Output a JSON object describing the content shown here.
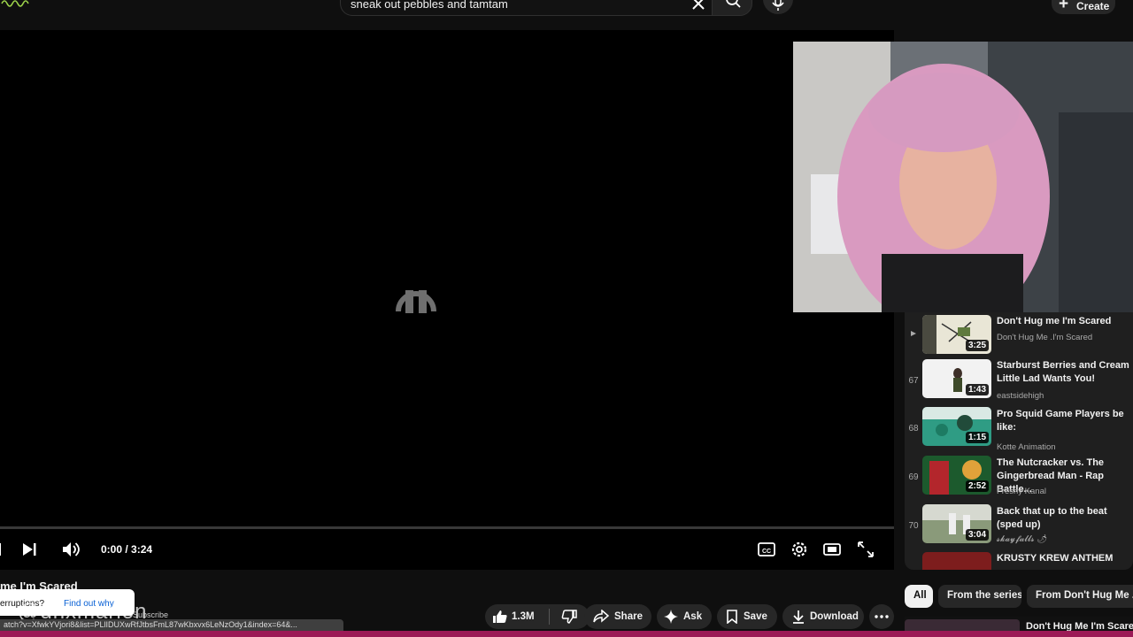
{
  "search": {
    "query": "sneak out pebbles and tamtam"
  },
  "header": {
    "create_label": "Create"
  },
  "player": {
    "time": "0:00 / 3:24",
    "progress_fraction": 0.0,
    "state": "loading"
  },
  "video": {
    "title_fragment": "me I'm Scared",
    "notice_question": "erruptions?",
    "notice_link": "Find out why",
    "watermark": "@dnxmarion",
    "subscribe_fragment": "Subscribe",
    "url_fragment": "atch?v=XfwkYVjori8&list=PLlIDUXwRfJtbsFmL87wKbxvx6LeNzOdy1&index=64&..."
  },
  "actions": {
    "like_count": "1.3M",
    "share": "Share",
    "ask": "Ask",
    "save": "Save",
    "download": "Download"
  },
  "playlist": [
    {
      "index": "",
      "now_playing": true,
      "title": "Don't Hug me I'm Scared",
      "channel": "Don't Hug Me .I'm Scared",
      "duration": "3:25"
    },
    {
      "index": "67",
      "title": "Starburst Berries and Cream Little Lad Wants You!",
      "channel": "eastsidehigh",
      "duration": "1:43"
    },
    {
      "index": "68",
      "title": "Pro Squid Game Players be like:",
      "channel": "Kotte Animation",
      "duration": "1:15"
    },
    {
      "index": "69",
      "title": "The Nutcracker vs. The Gingerbread Man - Rap Battle...",
      "channel": "Freshy Kanal",
      "duration": "2:52"
    },
    {
      "index": "70",
      "title": "Back that up to the beat (sped up)",
      "channel": "𝓼𝓴𝓪𝔂𝓯𝓪𝓵𝓵𝓼 🌶",
      "duration": "3:04"
    },
    {
      "index": "",
      "title": "KRUSTY KREW ANTHEM",
      "channel": "",
      "duration": ""
    }
  ],
  "chips": [
    "All",
    "From the series",
    "From Don't Hug Me .I'm"
  ],
  "related": {
    "first_title": "Don't Hug Me I'm Scared"
  },
  "colors": {
    "background": "#0f0f0f",
    "player": "#000000",
    "sidebar": "#1f1f1f",
    "accent_stripe": "#9c1a56",
    "link": "#065fd4"
  }
}
